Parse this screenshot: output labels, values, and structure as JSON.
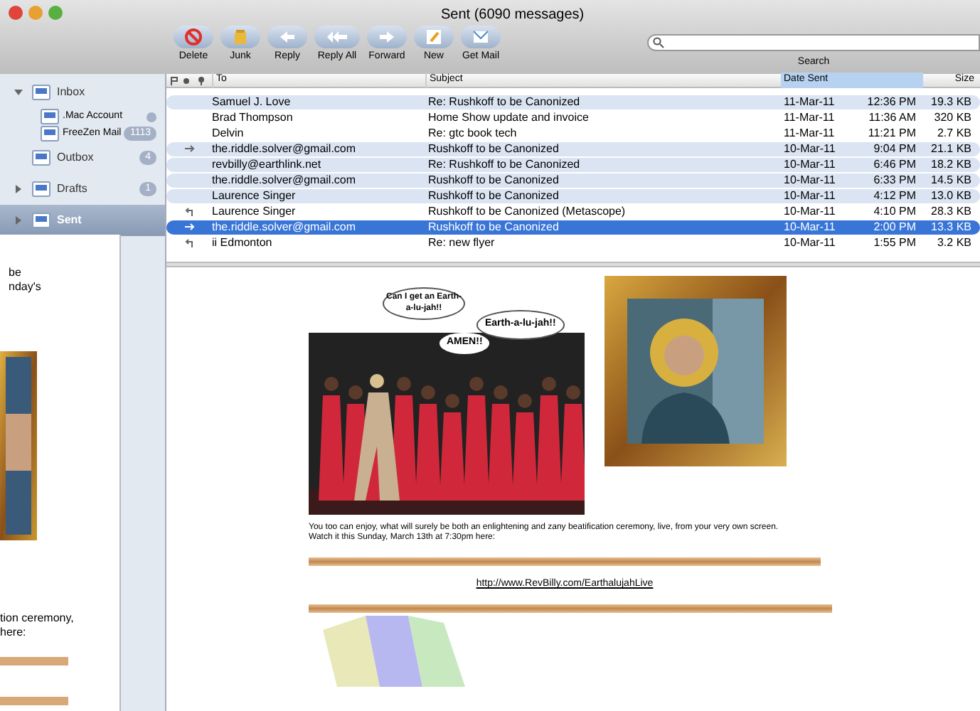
{
  "window": {
    "title": "Sent (6090 messages)"
  },
  "toolbar": [
    {
      "label": "Delete",
      "kind": "delete"
    },
    {
      "label": "Junk",
      "kind": "junk"
    },
    {
      "label": "Reply",
      "kind": "reply"
    },
    {
      "label": "Reply All",
      "kind": "replyall"
    },
    {
      "label": "Forward",
      "kind": "forward"
    },
    {
      "label": "New",
      "kind": "new"
    },
    {
      "label": "Get Mail",
      "kind": "getmail"
    }
  ],
  "search": {
    "label": "Search"
  },
  "sidebar": {
    "items": [
      {
        "label": "Inbox",
        "expanded": true,
        "selected": false,
        "children": [
          {
            "label": ".Mac Account"
          },
          {
            "label": "FreeZen Mail",
            "badge": "1113"
          }
        ]
      },
      {
        "label": "Outbox",
        "badge": "4",
        "selected": false
      },
      {
        "label": "Drafts",
        "badge": "1",
        "selected": false,
        "expanded": false
      },
      {
        "label": "Sent",
        "selected": true,
        "expanded": false
      }
    ]
  },
  "table": {
    "columns": [
      "To",
      "Subject",
      "Date Sent",
      "Size"
    ],
    "rows": [
      {
        "replied": false,
        "forwarded": false,
        "to": "Samuel J. Love",
        "subject": "Re: Rushkoff to be Canonized",
        "date": "11-Mar-11",
        "time": "12:36 PM",
        "size": "19.3 KB",
        "related": true,
        "selected": false
      },
      {
        "replied": false,
        "forwarded": false,
        "to": "Brad Thompson",
        "subject": "Home Show update and invoice",
        "date": "11-Mar-11",
        "time": "11:36 AM",
        "size": "320 KB",
        "related": false,
        "selected": false
      },
      {
        "replied": false,
        "forwarded": false,
        "to": "Delvin",
        "subject": "Re: gtc book tech",
        "date": "11-Mar-11",
        "time": "11:21 PM",
        "size": "2.7 KB",
        "related": false,
        "selected": false
      },
      {
        "replied": false,
        "forwarded": true,
        "to": "the.riddle.solver@gmail.com",
        "subject": "Rushkoff to be Canonized",
        "date": "10-Mar-11",
        "time": "9:04 PM",
        "size": "21.1 KB",
        "related": true,
        "selected": false
      },
      {
        "replied": false,
        "forwarded": false,
        "to": "revbilly@earthlink.net",
        "subject": "Re: Rushkoff to be Canonized",
        "date": "10-Mar-11",
        "time": "6:46 PM",
        "size": "18.2 KB",
        "related": true,
        "selected": false
      },
      {
        "replied": false,
        "forwarded": false,
        "to": "the.riddle.solver@gmail.com",
        "subject": "Rushkoff to be Canonized",
        "date": "10-Mar-11",
        "time": "6:33 PM",
        "size": "14.5 KB",
        "related": true,
        "selected": false
      },
      {
        "replied": false,
        "forwarded": false,
        "to": "Laurence Singer",
        "subject": "Rushkoff to be Canonized",
        "date": "10-Mar-11",
        "time": "4:12 PM",
        "size": "13.0 KB",
        "related": true,
        "selected": false
      },
      {
        "replied": true,
        "forwarded": false,
        "to": "Laurence Singer",
        "subject": "Rushkoff to be Canonized (Metascope)",
        "date": "10-Mar-11",
        "time": "4:10 PM",
        "size": "28.3 KB",
        "related": false,
        "selected": false
      },
      {
        "replied": false,
        "forwarded": true,
        "to": "the.riddle.solver@gmail.com",
        "subject": "Rushkoff to be Canonized",
        "date": "10-Mar-11",
        "time": "2:00 PM",
        "size": "13.3 KB",
        "related": true,
        "selected": true
      },
      {
        "replied": true,
        "forwarded": false,
        "to": "ii Edmonton",
        "subject": "Re: new flyer",
        "date": "10-Mar-11",
        "time": "1:55 PM",
        "size": "3.2 KB",
        "related": false,
        "selected": false
      }
    ]
  },
  "message": {
    "bubbles": [
      "Can I get an Earth-a-lu-jah!!",
      "Earth-a-lu-jah!!",
      "AMEN!!"
    ],
    "body": [
      "You too can enjoy, what will surely be both an enlightening and zany beatification ceremony, live, from your very own screen.",
      "Watch it this Sunday, March 13th at 7:30pm here:"
    ],
    "link": "http://www.RevBilly.com/EarthalujahLive"
  },
  "back_window": {
    "lines": [
      "be",
      "nday's",
      "tion ceremony,",
      "here:"
    ]
  }
}
